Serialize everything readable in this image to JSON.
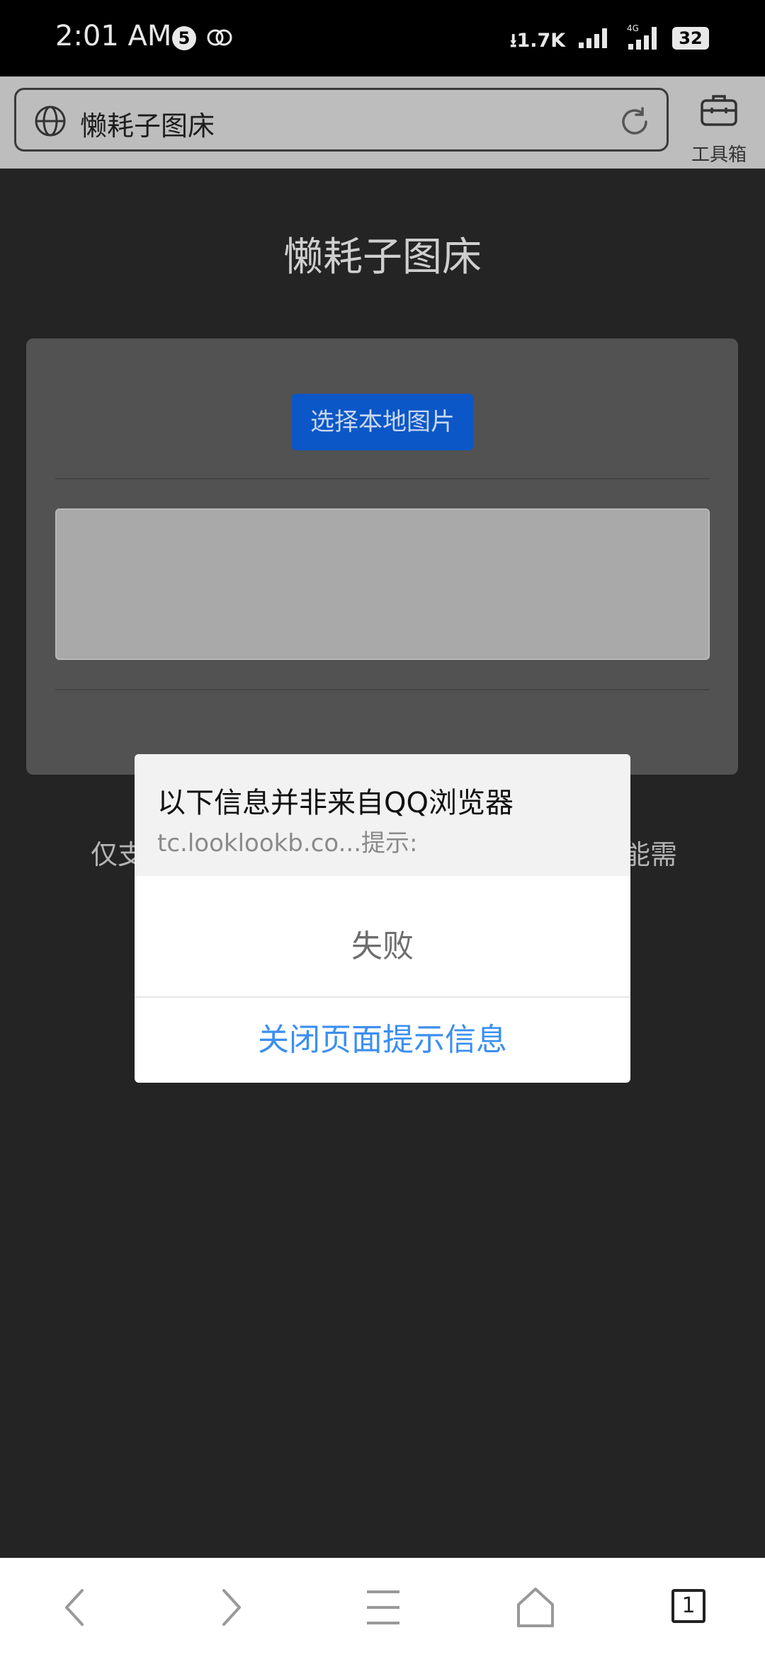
{
  "status_bar": {
    "time": "2:01 AM",
    "notification_count": "5",
    "net_speed": "1.7K",
    "battery": "32"
  },
  "browser": {
    "url_text": "懒耗子图床",
    "toolbox_label": "工具箱",
    "tab_count": "1"
  },
  "page": {
    "title": "懒耗子图床",
    "select_button": "选择本地图片",
    "note_left": "仅支",
    "note_right": "能需"
  },
  "dialog": {
    "title": "以下信息并非来自QQ浏览器",
    "subtitle": "tc.looklookb.co...提示:",
    "message": "失败",
    "close_button": "关闭页面提示信息"
  },
  "colors": {
    "accent": "#0b57c7",
    "dialog_link": "#3b8ff0",
    "page_bg": "#242424"
  }
}
